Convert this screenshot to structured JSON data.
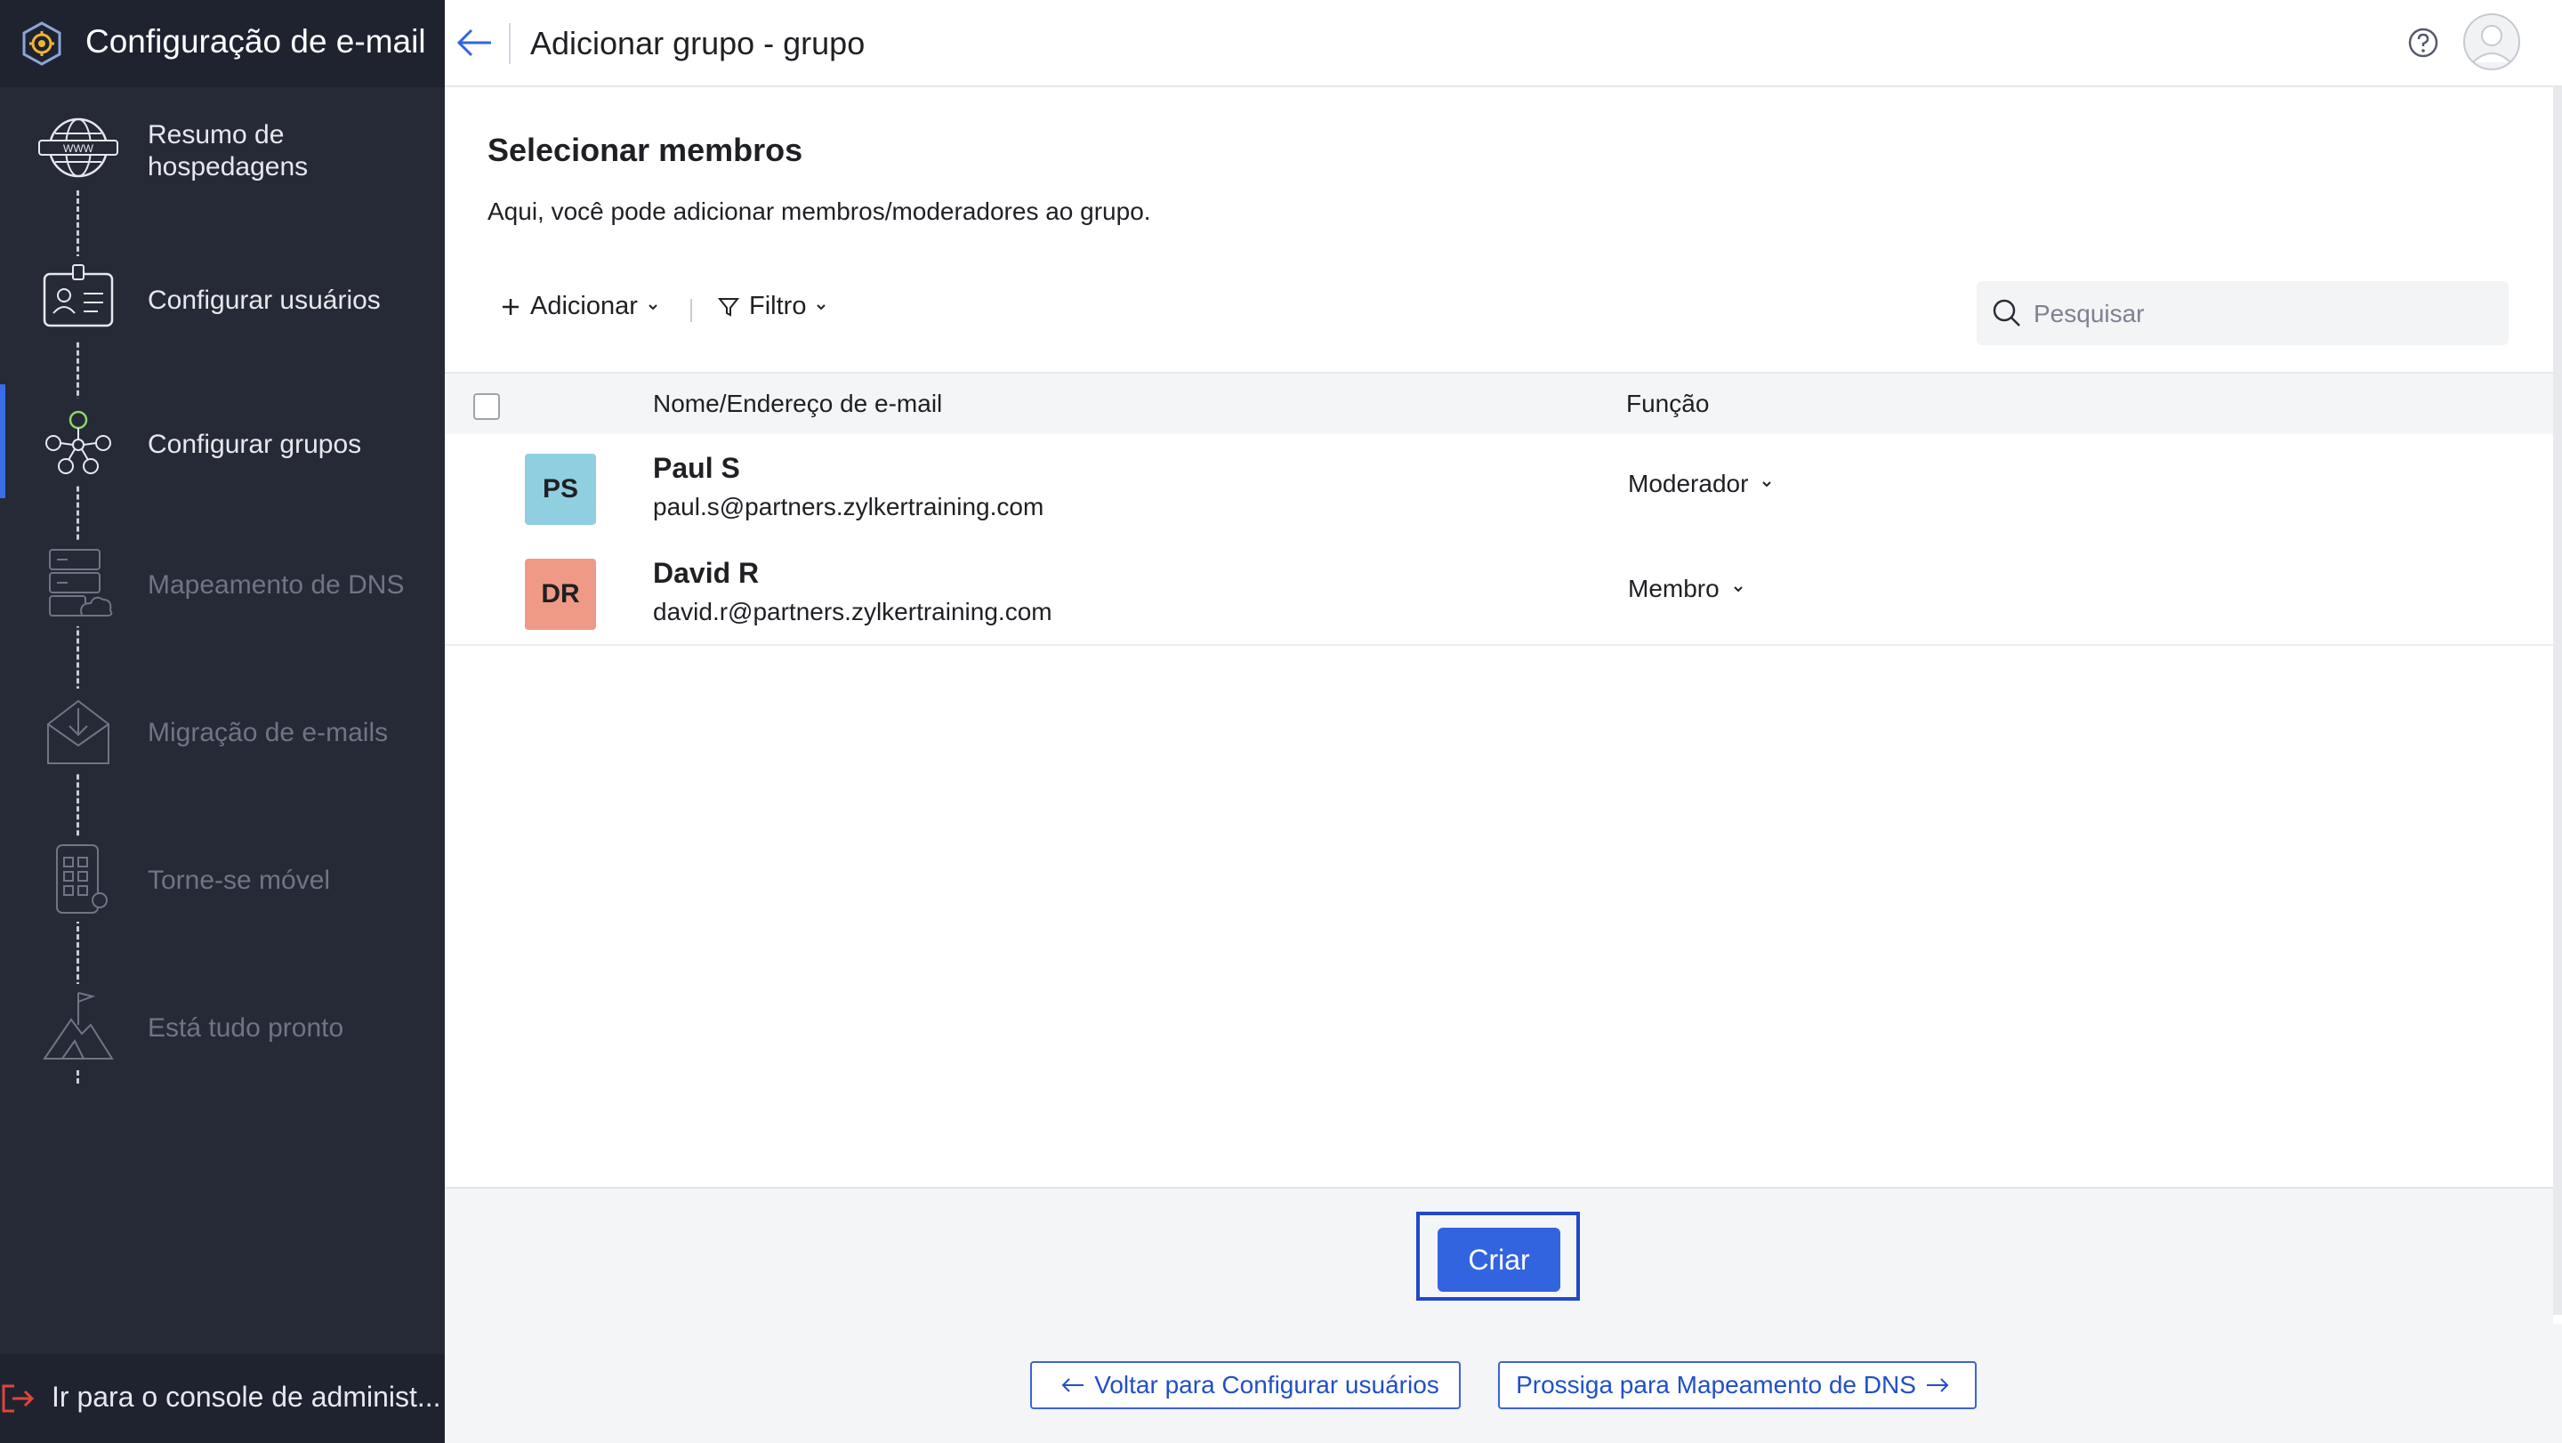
{
  "sidebar": {
    "title": "Configuração de e-mail",
    "steps": [
      {
        "label": "Resumo de hospedagens",
        "state": "done"
      },
      {
        "label": "Configurar usuários",
        "state": "done"
      },
      {
        "label": "Configurar grupos",
        "state": "active"
      },
      {
        "label": "Mapeamento de DNS",
        "state": "disabled"
      },
      {
        "label": "Migração de e-mails",
        "state": "disabled"
      },
      {
        "label": "Torne-se móvel",
        "state": "disabled"
      },
      {
        "label": "Está tudo pronto",
        "state": "disabled"
      }
    ],
    "footer_label": "Ir para o console de administ..."
  },
  "header": {
    "title": "Adicionar grupo - grupo"
  },
  "section": {
    "title": "Selecionar membros",
    "description": "Aqui, você pode adicionar membros/moderadores ao grupo."
  },
  "toolbar": {
    "add_label": "Adicionar",
    "filter_label": "Filtro"
  },
  "search": {
    "placeholder": "Pesquisar"
  },
  "table": {
    "columns": [
      "Nome/Endereço de e-mail",
      "Função"
    ],
    "rows": [
      {
        "initials": "PS",
        "name": "Paul S",
        "email": "paul.s@partners.zylkertraining.com",
        "role": "Moderador",
        "badge_color": "#8fcfe0"
      },
      {
        "initials": "DR",
        "name": "David R",
        "email": "david.r@partners.zylkertraining.com",
        "role": "Membro",
        "badge_color": "#ef9a86"
      }
    ]
  },
  "actions": {
    "create_label": "Criar"
  },
  "bottom_nav": {
    "back_label": "Voltar para Configurar usuários",
    "next_label": "Prossiga para Mapeamento de DNS"
  },
  "colors": {
    "accent": "#3264e0",
    "sidebar_bg": "#252a36",
    "highlight": "#2048c8"
  }
}
